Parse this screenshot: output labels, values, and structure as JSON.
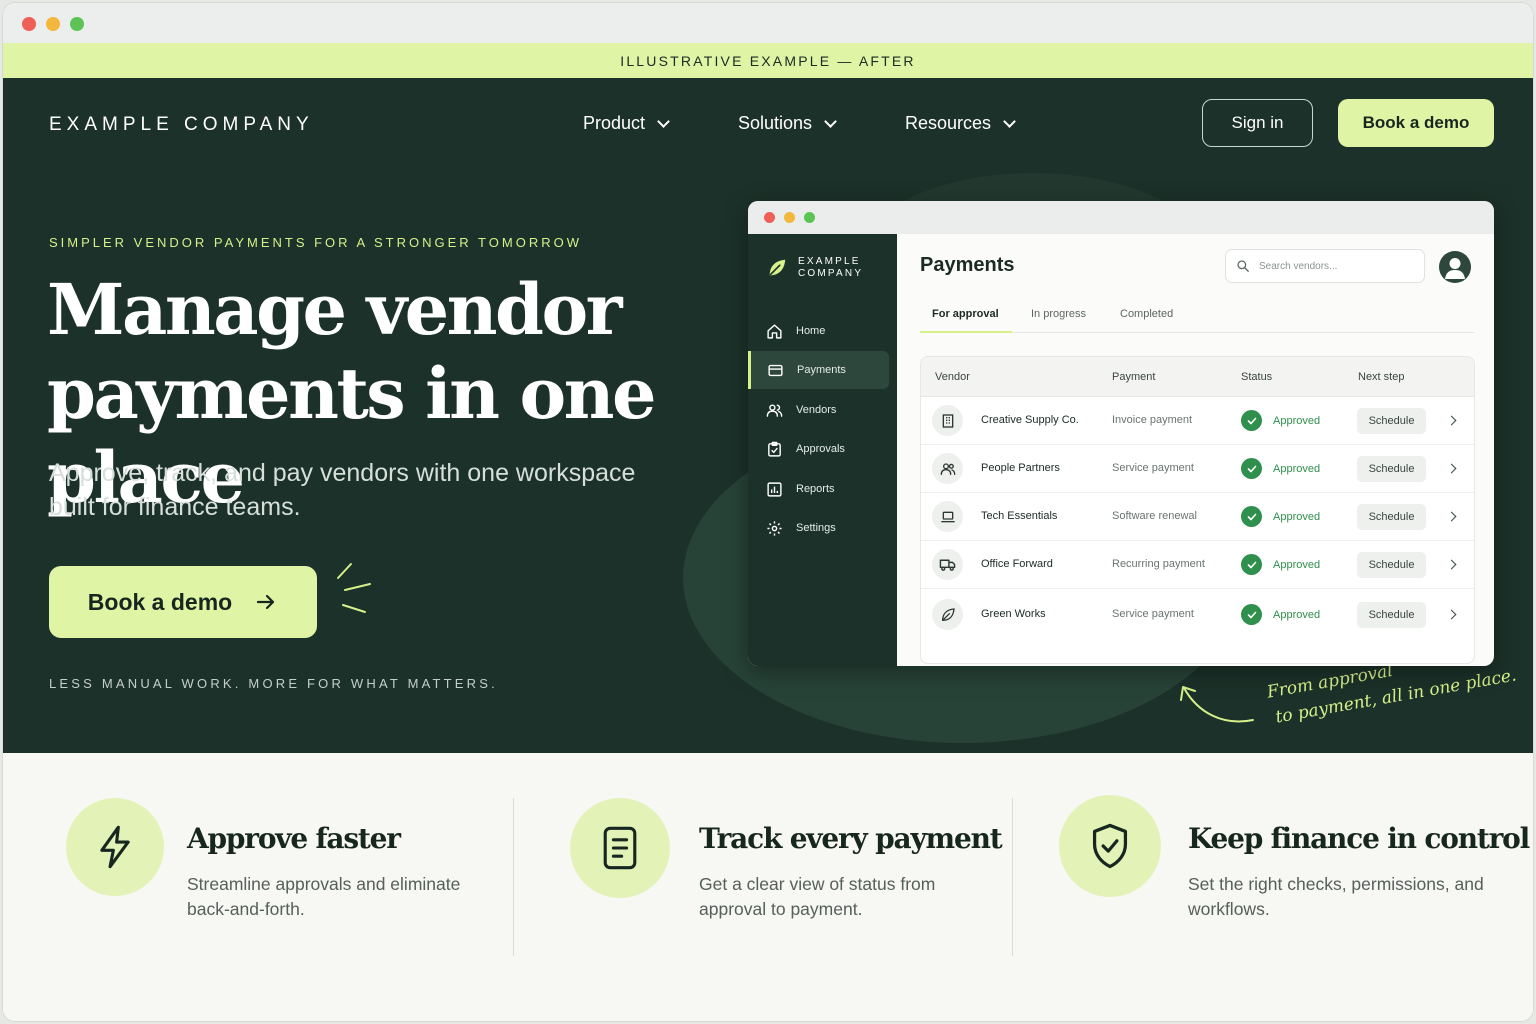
{
  "banner": {
    "text": "ILLUSTRATIVE EXAMPLE — AFTER"
  },
  "header": {
    "logo": "EXAMPLE COMPANY",
    "nav": [
      {
        "label": "Product",
        "icon": "chevron-down-icon"
      },
      {
        "label": "Solutions",
        "icon": "chevron-down-icon"
      },
      {
        "label": "Resources",
        "icon": "chevron-down-icon"
      }
    ],
    "sign_in_label": "Sign in",
    "book_demo_label": "Book a demo"
  },
  "hero": {
    "eyebrow": "SIMPLER VENDOR PAYMENTS FOR A STRONGER TOMORROW",
    "headline_line1": "Manage vendor",
    "headline_line2": "payments in one place",
    "subline": "Approve, track, and pay vendors with one workspace built for finance teams.",
    "cta_label": "Book a demo",
    "cta_icon": "arrow-right-icon",
    "tagline": "LESS MANUAL WORK. MORE FOR WHAT MATTERS.",
    "annotation_line1": "From approval",
    "annotation_line2": "to payment, all in one place."
  },
  "app": {
    "logo_line1": "EXAMPLE",
    "logo_line2": "COMPANY",
    "sidebar": [
      {
        "label": "Home",
        "icon": "home-icon"
      },
      {
        "label": "Payments",
        "icon": "card-icon",
        "active": true
      },
      {
        "label": "Vendors",
        "icon": "users-icon"
      },
      {
        "label": "Approvals",
        "icon": "clipboard-check-icon"
      },
      {
        "label": "Reports",
        "icon": "chart-icon"
      },
      {
        "label": "Settings",
        "icon": "gear-icon"
      }
    ],
    "title": "Payments",
    "search_placeholder": "Search vendors...",
    "tabs": [
      "For approval",
      "In progress",
      "Completed"
    ],
    "active_tab": "For approval",
    "columns": [
      "Vendor",
      "Payment",
      "Status",
      "Next step"
    ],
    "rows": [
      {
        "vendor": "Creative Supply Co.",
        "payment": "Invoice payment",
        "status": "Approved",
        "action": "Schedule",
        "icon": "building-icon"
      },
      {
        "vendor": "People Partners",
        "payment": "Service payment",
        "status": "Approved",
        "action": "Schedule",
        "icon": "users-icon"
      },
      {
        "vendor": "Tech Essentials",
        "payment": "Software renewal",
        "status": "Approved",
        "action": "Schedule",
        "icon": "laptop-icon"
      },
      {
        "vendor": "Office Forward",
        "payment": "Recurring payment",
        "status": "Approved",
        "action": "Schedule",
        "icon": "truck-icon"
      },
      {
        "vendor": "Green Works",
        "payment": "Service payment",
        "status": "Approved",
        "action": "Schedule",
        "icon": "leaf-icon"
      }
    ]
  },
  "features": [
    {
      "title": "Approve faster",
      "desc": "Streamline approvals and eliminate back-and-forth.",
      "icon": "lightning-icon"
    },
    {
      "title": "Track every payment",
      "desc": "Get a clear view of status from approval to payment.",
      "icon": "document-icon"
    },
    {
      "title": "Keep finance in control",
      "desc": "Set the right checks, permissions, and workflows.",
      "icon": "shield-check-icon"
    }
  ],
  "colors": {
    "dark_green": "#1c3129",
    "lime": "#e0f4a6",
    "accent_text": "#d6f08a",
    "approved": "#2f8f4c"
  }
}
